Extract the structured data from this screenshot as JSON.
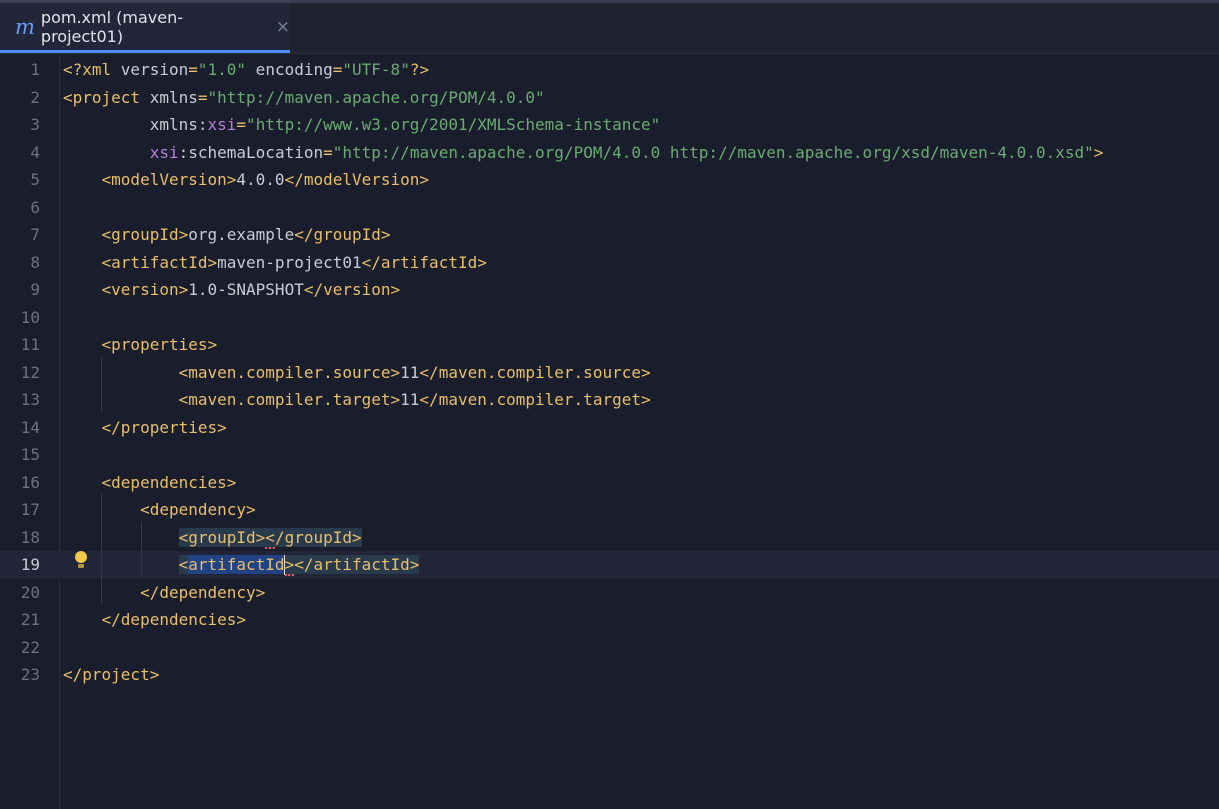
{
  "tab": {
    "icon": "m",
    "title": "pom.xml (maven-project01)",
    "close": "×"
  },
  "lines": [
    {
      "n": "1",
      "c": [
        [
          "t",
          "<?xml "
        ],
        [
          "a",
          "version"
        ],
        [
          "t",
          "="
        ],
        [
          "s",
          "\"1.0\""
        ],
        [
          "a",
          " encoding"
        ],
        [
          "t",
          "="
        ],
        [
          "s",
          "\"UTF-8\""
        ],
        [
          "t",
          "?>"
        ]
      ]
    },
    {
      "n": "2",
      "c": [
        [
          "t",
          "<project "
        ],
        [
          "a",
          "xmlns"
        ],
        [
          "t",
          "="
        ],
        [
          "s",
          "\"http://maven.apache.org/POM/4.0.0\""
        ]
      ]
    },
    {
      "n": "3",
      "c": [
        [
          "a",
          "         xmlns:"
        ],
        [
          "ns",
          "xsi"
        ],
        [
          "t",
          "="
        ],
        [
          "s",
          "\"http://www.w3.org/2001/XMLSchema-instance\""
        ]
      ]
    },
    {
      "n": "4",
      "c": [
        [
          "a",
          "         "
        ],
        [
          "ns",
          "xsi"
        ],
        [
          "a",
          ":schemaLocation"
        ],
        [
          "t",
          "="
        ],
        [
          "s",
          "\"http://maven.apache.org/POM/4.0.0 http://maven.apache.org/xsd/maven-4.0.0.xsd\""
        ],
        [
          "t",
          ">"
        ]
      ]
    },
    {
      "n": "5",
      "c": [
        [
          "x",
          "    "
        ],
        [
          "t",
          "<modelVersion>"
        ],
        [
          "x",
          "4.0.0"
        ],
        [
          "t",
          "</modelVersion>"
        ]
      ]
    },
    {
      "n": "6",
      "c": []
    },
    {
      "n": "7",
      "c": [
        [
          "x",
          "    "
        ],
        [
          "t",
          "<groupId>"
        ],
        [
          "x",
          "org.example"
        ],
        [
          "t",
          "</groupId>"
        ]
      ]
    },
    {
      "n": "8",
      "c": [
        [
          "x",
          "    "
        ],
        [
          "t",
          "<artifactId>"
        ],
        [
          "x",
          "maven-project01"
        ],
        [
          "t",
          "</artifactId>"
        ]
      ]
    },
    {
      "n": "9",
      "c": [
        [
          "x",
          "    "
        ],
        [
          "t",
          "<version>"
        ],
        [
          "x",
          "1.0-SNAPSHOT"
        ],
        [
          "t",
          "</version>"
        ]
      ]
    },
    {
      "n": "10",
      "c": []
    },
    {
      "n": "11",
      "c": [
        [
          "x",
          "    "
        ],
        [
          "t",
          "<properties>"
        ]
      ]
    },
    {
      "n": "12",
      "c": [
        [
          "x",
          "            "
        ],
        [
          "t",
          "<maven.compiler.source>"
        ],
        [
          "x",
          "11"
        ],
        [
          "t",
          "</maven.compiler.source>"
        ]
      ]
    },
    {
      "n": "13",
      "c": [
        [
          "x",
          "            "
        ],
        [
          "t",
          "<maven.compiler.target>"
        ],
        [
          "x",
          "11"
        ],
        [
          "t",
          "</maven.compiler.target>"
        ]
      ]
    },
    {
      "n": "14",
      "c": [
        [
          "x",
          "    "
        ],
        [
          "t",
          "</properties>"
        ]
      ]
    },
    {
      "n": "15",
      "c": []
    },
    {
      "n": "16",
      "c": [
        [
          "x",
          "    "
        ],
        [
          "t",
          "<dependencies>"
        ]
      ]
    },
    {
      "n": "17",
      "c": [
        [
          "x",
          "        "
        ],
        [
          "t",
          "<dependency>"
        ]
      ]
    },
    {
      "n": "18",
      "c": [
        [
          "x",
          "            "
        ],
        [
          "t hl-tag",
          "<groupId>"
        ],
        [
          "t hl-tag squiggle",
          "<"
        ],
        [
          "t hl-tag",
          "/groupId>"
        ]
      ]
    },
    {
      "n": "19",
      "c": [
        [
          "x",
          "            "
        ],
        [
          "t hl-tag",
          "<"
        ],
        [
          "sel",
          "artifactId"
        ],
        [
          "cursor",
          ""
        ],
        [
          "t hl-tag squiggle",
          ">"
        ],
        [
          "t hl-tag",
          "</artifactId>"
        ]
      ],
      "current": true
    },
    {
      "n": "20",
      "c": [
        [
          "x",
          "        "
        ],
        [
          "t",
          "</dependency>"
        ]
      ]
    },
    {
      "n": "21",
      "c": [
        [
          "x",
          "    "
        ],
        [
          "t",
          "</dependencies>"
        ]
      ]
    },
    {
      "n": "22",
      "c": []
    },
    {
      "n": "23",
      "c": [
        [
          "t",
          "</project>"
        ]
      ]
    }
  ]
}
